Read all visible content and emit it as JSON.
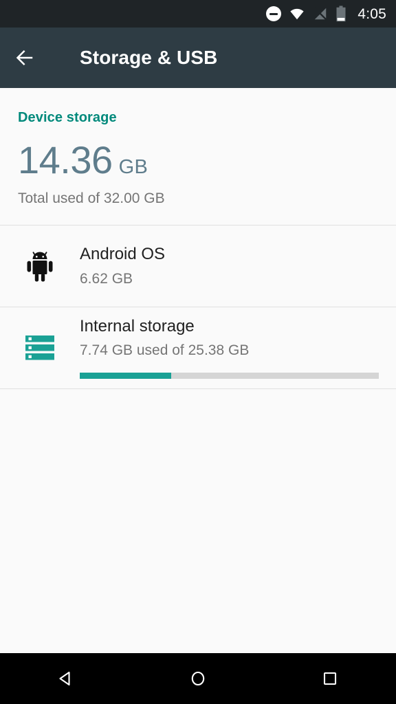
{
  "status_bar": {
    "time": "4:05",
    "icons": [
      {
        "name": "do-not-disturb-icon",
        "label": "Do not disturb"
      },
      {
        "name": "wifi-icon",
        "label": "Wi-Fi connected"
      },
      {
        "name": "signal-off-icon",
        "label": "No SIM / signal off"
      },
      {
        "name": "battery-icon",
        "label": "Battery low"
      }
    ],
    "background": "#1f2427",
    "foreground": "#ffffff"
  },
  "app_bar": {
    "title": "Storage & USB",
    "back_icon": "arrow-back-icon",
    "background": "#2e3c44",
    "title_color": "#ffffff"
  },
  "main": {
    "section_label": "Device storage",
    "section_label_color": "#00897b",
    "summary": {
      "number": "14.36",
      "unit": "GB",
      "caption": "Total used of 32.00 GB",
      "number_color": "#5f7d8c"
    },
    "rows": [
      {
        "id": "android-os",
        "icon": "android-robot-icon",
        "title": "Android OS",
        "subtitle": "6.62 GB",
        "has_progress": false
      },
      {
        "id": "internal-storage",
        "icon": "internal-storage-icon",
        "title": "Internal storage",
        "subtitle": "7.74 GB used of 25.38 GB",
        "has_progress": true,
        "progress_percent": 30.5,
        "progress_fill_color": "#1aa195",
        "progress_track_color": "#d5d5d5"
      }
    ]
  },
  "nav_bar": {
    "background": "#000000",
    "buttons": [
      {
        "name": "nav-back-button",
        "icon": "triangle-back-icon",
        "label": "Back"
      },
      {
        "name": "nav-home-button",
        "icon": "circle-home-icon",
        "label": "Home"
      },
      {
        "name": "nav-recents-button",
        "icon": "square-recents-icon",
        "label": "Recents"
      }
    ]
  }
}
